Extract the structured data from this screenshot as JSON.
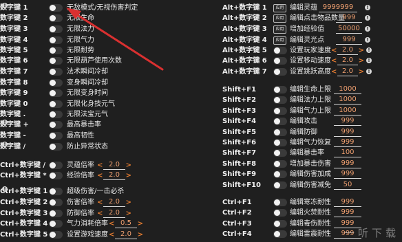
{
  "left": [
    {
      "hotkey": "数字键 1",
      "label": "无敌模式/无视伤害判定",
      "info": true
    },
    {
      "hotkey": "数字键 2",
      "label": "无限生命"
    },
    {
      "hotkey": "数字键 3",
      "label": "无限法力"
    },
    {
      "hotkey": "数字键 4",
      "label": "无限气力"
    },
    {
      "hotkey": "数字键 5",
      "label": "无限耐势"
    },
    {
      "hotkey": "数字键 6",
      "label": "无限葫芦使用次数"
    },
    {
      "hotkey": "数字键 7",
      "label": "法术瞬间冷却"
    },
    {
      "hotkey": "数字键 8",
      "label": "变身瞬间冷却"
    },
    {
      "hotkey": "数字键 9",
      "label": "无限变身时间"
    },
    {
      "hotkey": "数字键 0",
      "label": "无限化身技元气"
    },
    {
      "hotkey": "数字键 .",
      "label": "无限法宝元气"
    },
    {
      "hotkey": "数字键 +",
      "label": "最高暴击率",
      "info": true
    },
    {
      "hotkey": "数字键 -",
      "label": "最高韧性"
    },
    {
      "hotkey": "数字键 /",
      "label": "防止异常状态",
      "info": true
    },
    {
      "hotkey": "Ctrl+数字键 /",
      "label": "灵蕴倍率",
      "stepper": "2.0"
    },
    {
      "hotkey": "Ctrl+数字键 *",
      "label": "经验倍率",
      "stepper": "2.0"
    },
    {
      "hotkey": "Ctrl+数字键 1",
      "label": "超级伤害/一击必杀",
      "info": true
    },
    {
      "hotkey": "Ctrl+数字键 2",
      "label": "伤害倍率",
      "stepper": "2.0"
    },
    {
      "hotkey": "Ctrl+数字键 3",
      "label": "防御倍率",
      "stepper": "2.0"
    },
    {
      "hotkey": "Ctrl+数字键 4",
      "label": "气力消耗倍率",
      "stepper": "0.5"
    },
    {
      "hotkey": "Ctrl+数字键 5",
      "label": "设置游戏速度",
      "stepper": "2.0"
    }
  ],
  "right": [
    {
      "hotkey": "Alt+数字键 1",
      "kind": "apply",
      "apply": "应用",
      "label": "编辑灵蕴",
      "value": "9999999"
    },
    {
      "hotkey": "Alt+数字键 2",
      "kind": "apply",
      "apply": "应用",
      "label": "编辑点击物品数量",
      "value": "999"
    },
    {
      "hotkey": "Alt+数字键 3",
      "kind": "apply",
      "apply": "应用",
      "label": "增加经验值",
      "value": "50000"
    },
    {
      "hotkey": "Alt+数字键 4",
      "kind": "apply",
      "apply": "应用",
      "label": "编辑灵光点",
      "value": "999"
    },
    {
      "hotkey": "Alt+数字键 5",
      "kind": "stepper",
      "label": "设置玩家速度",
      "value": "2.0"
    },
    {
      "hotkey": "Alt+数字键 6",
      "kind": "stepper",
      "label": "设置移动速度",
      "value": "2.0"
    },
    {
      "hotkey": "Alt+数字键 7",
      "kind": "stepper",
      "label": "设置跳跃高度",
      "value": "2.0"
    },
    {
      "hotkey": "Shift+F1",
      "kind": "toggle",
      "label": "编辑生命上限",
      "value": "1000"
    },
    {
      "hotkey": "Shift+F2",
      "kind": "toggle",
      "label": "编辑法力上限",
      "value": "1000"
    },
    {
      "hotkey": "Shift+F3",
      "kind": "toggle",
      "label": "编辑气力上限",
      "value": "1000"
    },
    {
      "hotkey": "Shift+F4",
      "kind": "toggle",
      "label": "编辑攻击",
      "value": "999"
    },
    {
      "hotkey": "Shift+F5",
      "kind": "toggle",
      "label": "编辑防御",
      "value": "999"
    },
    {
      "hotkey": "Shift+F6",
      "kind": "toggle",
      "label": "编辑气力恢复",
      "value": "999"
    },
    {
      "hotkey": "Shift+F7",
      "kind": "toggle",
      "label": "编辑暴击率",
      "value": "100"
    },
    {
      "hotkey": "Shift+F8",
      "kind": "toggle",
      "label": "增加暴击伤害",
      "value": "999"
    },
    {
      "hotkey": "Shift+F9",
      "kind": "toggle",
      "label": "编辑伤害加成",
      "value": "999"
    },
    {
      "hotkey": "Shift+F10",
      "kind": "toggle",
      "label": "编辑伤害减免",
      "value": "50"
    },
    {
      "hotkey": "Ctrl+F1",
      "kind": "toggle",
      "label": "编辑寒冻耐性",
      "value": "999"
    },
    {
      "hotkey": "Ctrl+F2",
      "kind": "toggle",
      "label": "编辑火焚耐性",
      "value": "999"
    },
    {
      "hotkey": "Ctrl+F3",
      "kind": "toggle",
      "label": "编辑毒伤耐性",
      "value": "999"
    },
    {
      "hotkey": "Ctrl+F4",
      "kind": "toggle",
      "label": "编辑雷震耐性",
      "value": "999"
    }
  ],
  "glyphs": {
    "info": "!",
    "arrow_left": "<",
    "arrow_right": ">"
  },
  "colors": {
    "accent_orange": "#e07a30",
    "value_text": "#f0a070",
    "annotation_red": "#d93030"
  },
  "watermark": "一听下载"
}
